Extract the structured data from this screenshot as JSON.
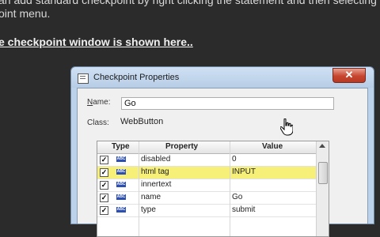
{
  "background": {
    "line1": "an add standard checkpoint by right clicking the statement and then selecting",
    "line2": "oint menu.",
    "heading": "e checkpoint window is shown here.."
  },
  "dialog": {
    "title": "Checkpoint Properties",
    "close_label": "✕",
    "name_label_prefix": "N",
    "name_label_rest": "ame:",
    "name_value": "Go",
    "class_label": "Class:",
    "class_value": "WebButton",
    "grid": {
      "headers": [
        "Type",
        "Property",
        "Value"
      ],
      "rows": [
        {
          "checked": true,
          "type": "ABC",
          "property": "disabled",
          "value": "0",
          "selected": false
        },
        {
          "checked": true,
          "type": "ABC",
          "property": "html tag",
          "value": "INPUT",
          "selected": true
        },
        {
          "checked": true,
          "type": "ABC",
          "property": "innertext",
          "value": "",
          "selected": false
        },
        {
          "checked": true,
          "type": "ABC",
          "property": "name",
          "value": "Go",
          "selected": false
        },
        {
          "checked": true,
          "type": "ABC",
          "property": "type",
          "value": "submit",
          "selected": false
        }
      ]
    }
  },
  "icons": {
    "title_icon": "dialog-window-icon",
    "cursor": "hand-pointer-icon"
  }
}
